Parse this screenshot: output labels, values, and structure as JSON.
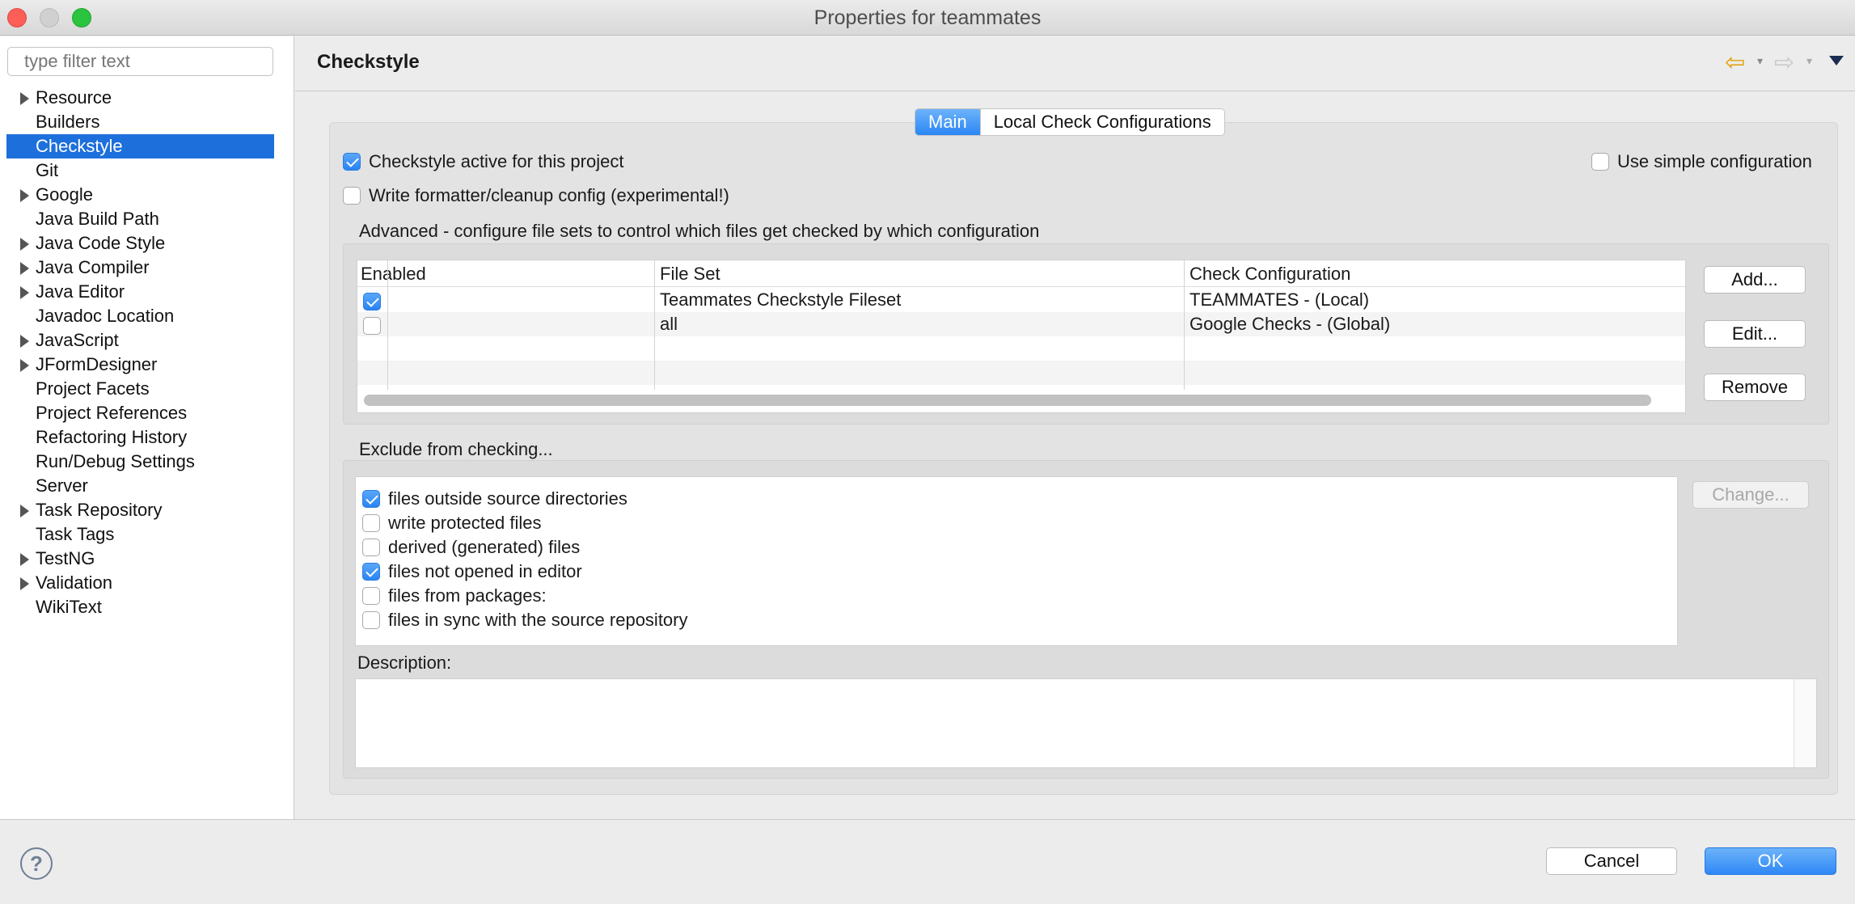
{
  "window": {
    "title": "Properties for teammates"
  },
  "sidebar": {
    "filter_placeholder": "type filter text",
    "items": [
      {
        "label": "Resource",
        "expandable": true
      },
      {
        "label": "Builders",
        "expandable": false
      },
      {
        "label": "Checkstyle",
        "expandable": false,
        "selected": true
      },
      {
        "label": "Git",
        "expandable": false
      },
      {
        "label": "Google",
        "expandable": true
      },
      {
        "label": "Java Build Path",
        "expandable": false
      },
      {
        "label": "Java Code Style",
        "expandable": true
      },
      {
        "label": "Java Compiler",
        "expandable": true
      },
      {
        "label": "Java Editor",
        "expandable": true
      },
      {
        "label": "Javadoc Location",
        "expandable": false
      },
      {
        "label": "JavaScript",
        "expandable": true
      },
      {
        "label": "JFormDesigner",
        "expandable": true
      },
      {
        "label": "Project Facets",
        "expandable": false
      },
      {
        "label": "Project References",
        "expandable": false
      },
      {
        "label": "Refactoring History",
        "expandable": false
      },
      {
        "label": "Run/Debug Settings",
        "expandable": false
      },
      {
        "label": "Server",
        "expandable": false
      },
      {
        "label": "Task Repository",
        "expandable": true
      },
      {
        "label": "Task Tags",
        "expandable": false
      },
      {
        "label": "TestNG",
        "expandable": true
      },
      {
        "label": "Validation",
        "expandable": true
      },
      {
        "label": "WikiText",
        "expandable": false
      }
    ]
  },
  "header": {
    "title": "Checkstyle",
    "back_icon": "back-arrow-icon",
    "forward_icon": "forward-arrow-icon",
    "back_glyph": "⇦",
    "forward_glyph": "⇨",
    "dropdown_glyph": "▾"
  },
  "tabs": [
    {
      "label": "Main",
      "active": true
    },
    {
      "label": "Local Check Configurations",
      "active": false
    }
  ],
  "options": {
    "active": {
      "label": "Checkstyle active for this project",
      "checked": true
    },
    "formatter": {
      "label": "Write formatter/cleanup config (experimental!)",
      "checked": false
    },
    "simple": {
      "label": "Use simple configuration",
      "checked": false
    }
  },
  "advanced": {
    "label": "Advanced - configure file sets to control which files get checked by which configuration",
    "columns": [
      "Enabled",
      "File Set",
      "Check Configuration"
    ],
    "rows": [
      {
        "enabled": true,
        "file_set": "Teammates Checkstyle Fileset",
        "config": "TEAMMATES  - (Local)"
      },
      {
        "enabled": false,
        "file_set": "all",
        "config": "Google Checks  - (Global)"
      }
    ],
    "buttons": {
      "add": "Add...",
      "edit": "Edit...",
      "remove": "Remove"
    }
  },
  "exclude": {
    "label": "Exclude from checking...",
    "items": [
      {
        "label": "files outside source directories",
        "checked": true
      },
      {
        "label": "write protected files",
        "checked": false
      },
      {
        "label": "derived (generated) files",
        "checked": false
      },
      {
        "label": "files not opened in editor",
        "checked": true
      },
      {
        "label": "files from packages:",
        "checked": false
      },
      {
        "label": "files in sync with the source repository",
        "checked": false
      }
    ],
    "change_button": "Change..."
  },
  "description": {
    "label": "Description:",
    "text": ""
  },
  "footer": {
    "help_glyph": "?",
    "cancel": "Cancel",
    "ok": "OK"
  },
  "colors": {
    "accent": "#2b86f5",
    "selection": "#1d6fdb",
    "close": "#fc5f57",
    "maximize": "#2ac43f"
  }
}
